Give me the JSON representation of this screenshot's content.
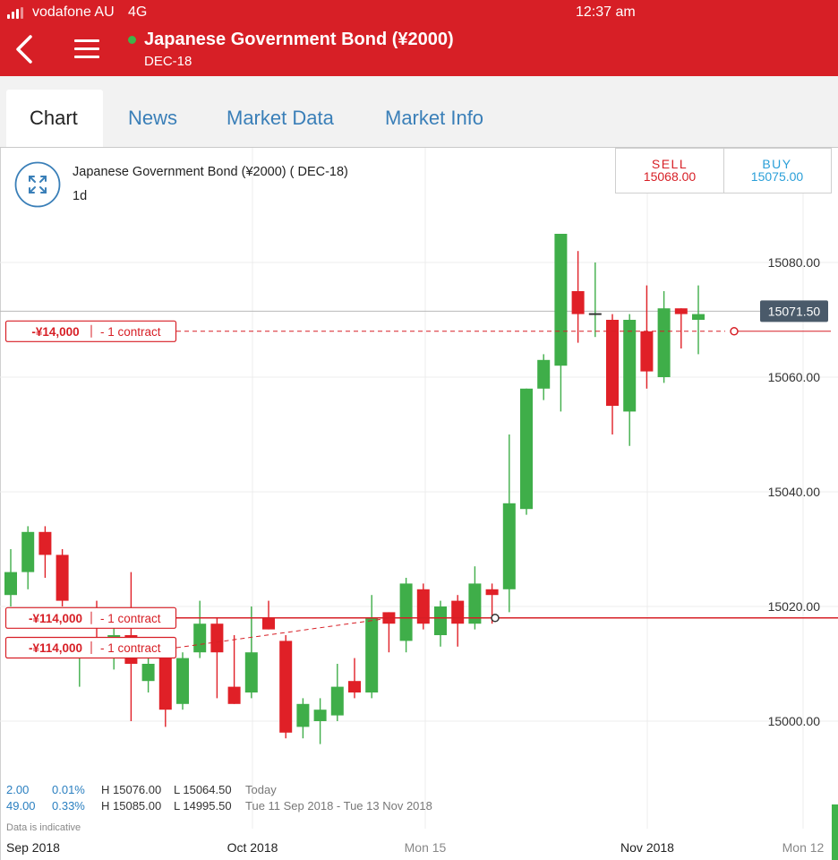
{
  "status_bar": {
    "carrier": "vodafone AU",
    "network": "4G",
    "time": "12:37 am"
  },
  "header": {
    "title": "Japanese Government Bond (¥2000)",
    "subtitle": "DEC-18",
    "back_icon": "chevron-left-icon",
    "menu_icon": "hamburger-menu-icon",
    "status_dot_color": "#3fb34a"
  },
  "tabs": [
    {
      "label": "Chart",
      "active": true
    },
    {
      "label": "News",
      "active": false
    },
    {
      "label": "Market Data",
      "active": false
    },
    {
      "label": "Market Info",
      "active": false
    }
  ],
  "chart_panel": {
    "instrument": "Japanese Government Bond (¥2000) ( DEC-18)",
    "interval": "1d",
    "expand_icon": "expand-arrows-icon",
    "sell": {
      "label": "SELL",
      "price": "15068.00"
    },
    "buy": {
      "label": "BUY",
      "price": "15075.00"
    },
    "current_price": "15071.50",
    "positions": [
      {
        "amount": "-¥14,000",
        "size": "- 1 contract",
        "level": 15068
      },
      {
        "amount": "-¥114,000",
        "size": "- 1 contract",
        "level": 15018
      },
      {
        "amount": "-¥114,000",
        "size": "- 1 contract",
        "level": 15013
      }
    ],
    "stats": [
      {
        "change": "2.00",
        "pct": "0.01%",
        "high": "H 15076.00",
        "low": "L 15064.50",
        "range": "Today"
      },
      {
        "change": "49.00",
        "pct": "0.33%",
        "high": "H 15085.00",
        "low": "L 14995.50",
        "range": "Tue 11 Sep 2018 - Tue 13 Nov 2018"
      }
    ],
    "disclaimer": "Data is indicative",
    "colors": {
      "up": "#3fae49",
      "down": "#e02027",
      "accent": "#d71f26",
      "buy": "#2a9fd8",
      "price_tag": "#4a5a6a"
    }
  },
  "chart_data": {
    "type": "candlestick",
    "ylim": [
      14980,
      15100
    ],
    "y_ticks": [
      "15080.00",
      "15060.00",
      "15040.00",
      "15020.00",
      "15000.00"
    ],
    "x_ticks": [
      "Sep 2018",
      "Oct 2018",
      "Mon 15",
      "Nov 2018",
      "Mon 12"
    ],
    "candles": [
      {
        "o": 15022,
        "h": 15030,
        "l": 15020,
        "c": 15026
      },
      {
        "o": 15026,
        "h": 15034,
        "l": 15023,
        "c": 15033
      },
      {
        "o": 15033,
        "h": 15034,
        "l": 15025,
        "c": 15029
      },
      {
        "o": 15029,
        "h": 15030,
        "l": 15020,
        "c": 15021
      },
      {
        "o": 15013,
        "h": 15014,
        "l": 15006,
        "c": 15013
      },
      {
        "o": 15012,
        "h": 15021,
        "l": 15011,
        "c": 15011
      },
      {
        "o": 15012,
        "h": 15019,
        "l": 15009,
        "c": 15015
      },
      {
        "o": 15015,
        "h": 15026,
        "l": 15000,
        "c": 15010
      },
      {
        "o": 15007,
        "h": 15013,
        "l": 15005,
        "c": 15010
      },
      {
        "o": 15011,
        "h": 15012,
        "l": 14999,
        "c": 15002
      },
      {
        "o": 15003,
        "h": 15012,
        "l": 15002,
        "c": 15011
      },
      {
        "o": 15012,
        "h": 15021,
        "l": 15011,
        "c": 15017
      },
      {
        "o": 15017,
        "h": 15018,
        "l": 15004,
        "c": 15012
      },
      {
        "o": 15006,
        "h": 15015,
        "l": 15003,
        "c": 15003
      },
      {
        "o": 15005,
        "h": 15020,
        "l": 15004,
        "c": 15012
      },
      {
        "o": 15018,
        "h": 15021,
        "l": 15016,
        "c": 15016
      },
      {
        "o": 15014,
        "h": 15015,
        "l": 14997,
        "c": 14998
      },
      {
        "o": 14999,
        "h": 15004,
        "l": 14997,
        "c": 15003
      },
      {
        "o": 15000,
        "h": 15004,
        "l": 14996,
        "c": 15002
      },
      {
        "o": 15001,
        "h": 15010,
        "l": 15000,
        "c": 15006
      },
      {
        "o": 15007,
        "h": 15011,
        "l": 15004,
        "c": 15005
      },
      {
        "o": 15005,
        "h": 15022,
        "l": 15004,
        "c": 15018
      },
      {
        "o": 15019,
        "h": 15019,
        "l": 15012,
        "c": 15017
      },
      {
        "o": 15014,
        "h": 15025,
        "l": 15012,
        "c": 15024
      },
      {
        "o": 15023,
        "h": 15024,
        "l": 15016,
        "c": 15017
      },
      {
        "o": 15015,
        "h": 15021,
        "l": 15013,
        "c": 15020
      },
      {
        "o": 15021,
        "h": 15022,
        "l": 15013,
        "c": 15017
      },
      {
        "o": 15017,
        "h": 15027,
        "l": 15016,
        "c": 15024
      },
      {
        "o": 15023,
        "h": 15024,
        "l": 15017,
        "c": 15022
      },
      {
        "o": 15023,
        "h": 15050,
        "l": 15019,
        "c": 15038
      },
      {
        "o": 15037,
        "h": 15058,
        "l": 15036,
        "c": 15058
      },
      {
        "o": 15058,
        "h": 15064,
        "l": 15056,
        "c": 15063
      },
      {
        "o": 15062,
        "h": 15085,
        "l": 15054,
        "c": 15085
      },
      {
        "o": 15075,
        "h": 15082,
        "l": 15066,
        "c": 15071
      },
      {
        "o": 15071,
        "h": 15080,
        "l": 15067,
        "c": 15071
      },
      {
        "o": 15070,
        "h": 15071,
        "l": 15050,
        "c": 15055
      },
      {
        "o": 15054,
        "h": 15071,
        "l": 15048,
        "c": 15070
      },
      {
        "o": 15068,
        "h": 15076,
        "l": 15058,
        "c": 15061
      },
      {
        "o": 15060,
        "h": 15075,
        "l": 15059,
        "c": 15072
      },
      {
        "o": 15072,
        "h": 15072,
        "l": 15065,
        "c": 15071
      },
      {
        "o": 15070,
        "h": 15076,
        "l": 15064,
        "c": 15071
      }
    ]
  }
}
